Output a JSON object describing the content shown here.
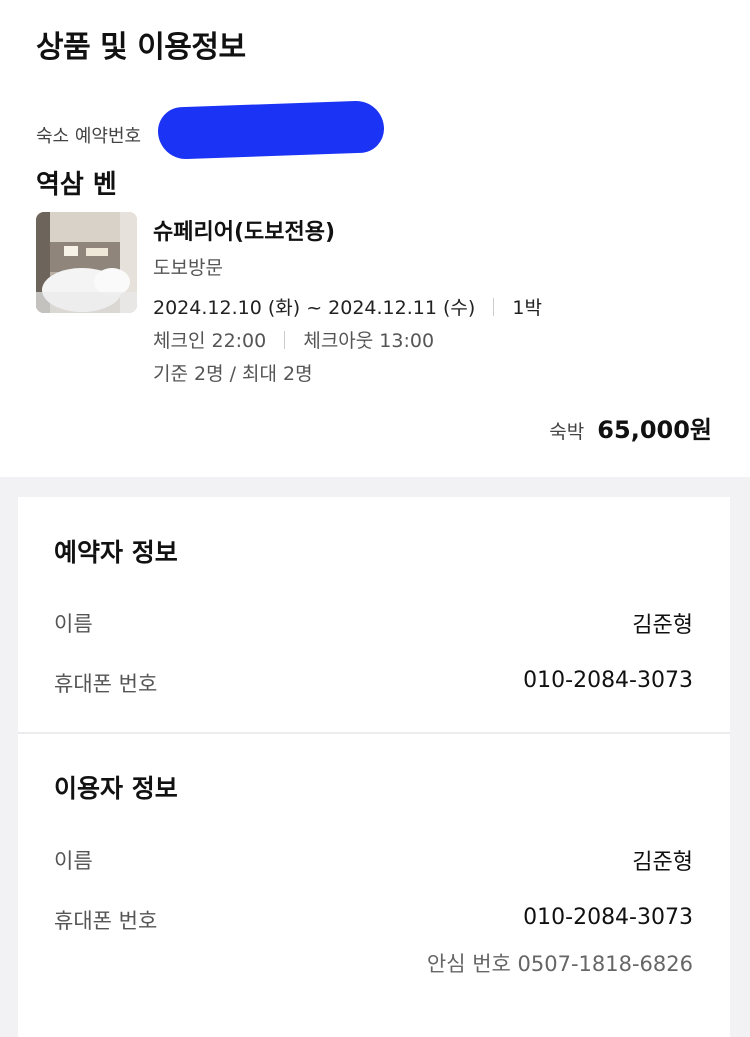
{
  "product_section": {
    "title": "상품 및 이용정보",
    "reservation_label": "숙소 예약번호",
    "hotel_name": "역삼 벤",
    "room_name": "슈페리어(도보전용)",
    "room_sub": "도보방문",
    "check_in_date": "2024.12.10 (화)",
    "date_separator": "~",
    "check_out_date": "2024.12.11 (수)",
    "nights": "1박",
    "check_in_time": "체크인 22:00",
    "check_out_time": "체크아웃 13:00",
    "capacity": "기준 2명 / 최대 2명",
    "price_label": "숙박",
    "price_value": "65,000원"
  },
  "booker": {
    "title": "예약자 정보",
    "name_label": "이름",
    "name_value": "김준형",
    "phone_label": "휴대폰 번호",
    "phone_value": "010-2084-3073"
  },
  "user": {
    "title": "이용자 정보",
    "name_label": "이름",
    "name_value": "김준형",
    "phone_label": "휴대폰 번호",
    "phone_value": "010-2084-3073",
    "safe_number": "안심 번호 0507-1818-6826"
  },
  "colors": {
    "redaction": "#1b33f5",
    "page_background": "#f2f2f4",
    "card_background": "#ffffff"
  }
}
